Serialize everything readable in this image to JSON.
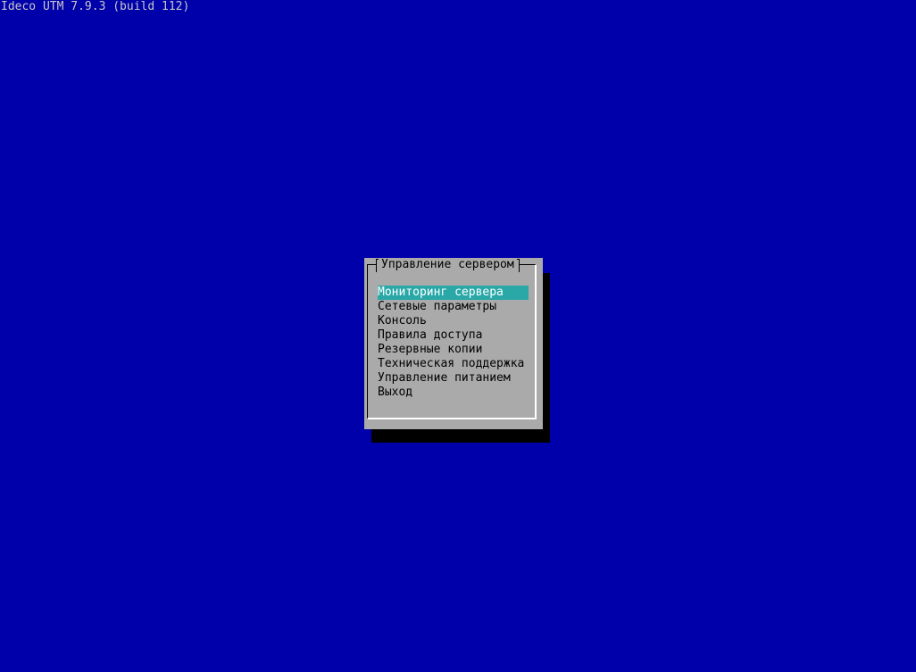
{
  "header": {
    "title": "Ideco UTM 7.9.3 (build 112)"
  },
  "dialog": {
    "title": "Управление сервером",
    "selected_index": 0,
    "items": [
      {
        "label": "Мониторинг сервера"
      },
      {
        "label": "Сетевые параметры"
      },
      {
        "label": "Консоль"
      },
      {
        "label": "Правила доступа"
      },
      {
        "label": "Резервные копии"
      },
      {
        "label": "Техническая поддержка"
      },
      {
        "label": "Управление питанием"
      },
      {
        "label": "Выход"
      }
    ]
  },
  "colors": {
    "background": "#0000aa",
    "dialog": "#aaaaaa",
    "highlight": "#2aa8a8",
    "shadow": "#000000"
  }
}
